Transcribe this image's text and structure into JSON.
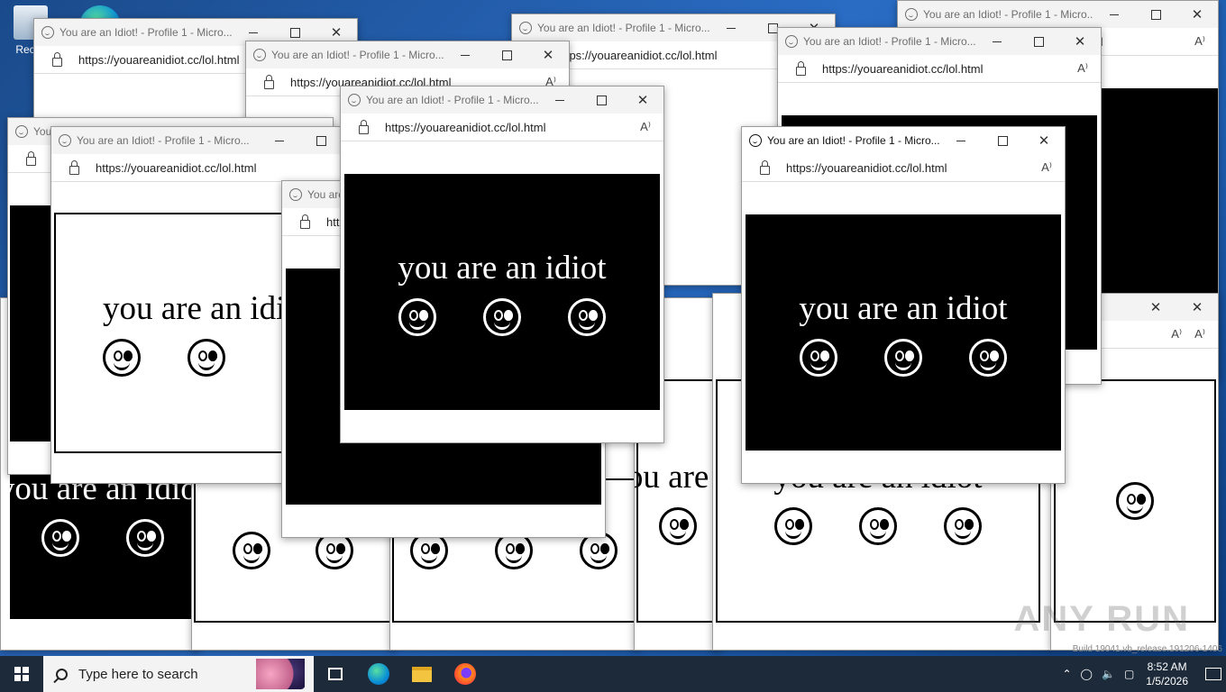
{
  "desktop": {
    "recycle_label": "Recyc"
  },
  "window_title": "You are an Idiot! - Profile 1 - Micro...",
  "url": "https://youareanidiot.cc/lol.html",
  "phrase": "you are an idiot",
  "read_aloud_glyph": "A⁾",
  "controls": {
    "close_glyph": "✕"
  },
  "taskbar": {
    "search_placeholder": "Type here to search",
    "time": "8:52 AM",
    "date": "1/5/2026"
  },
  "watermark": "ANY RUN",
  "build_text": "Build 19041.vb_release.191206-1406"
}
